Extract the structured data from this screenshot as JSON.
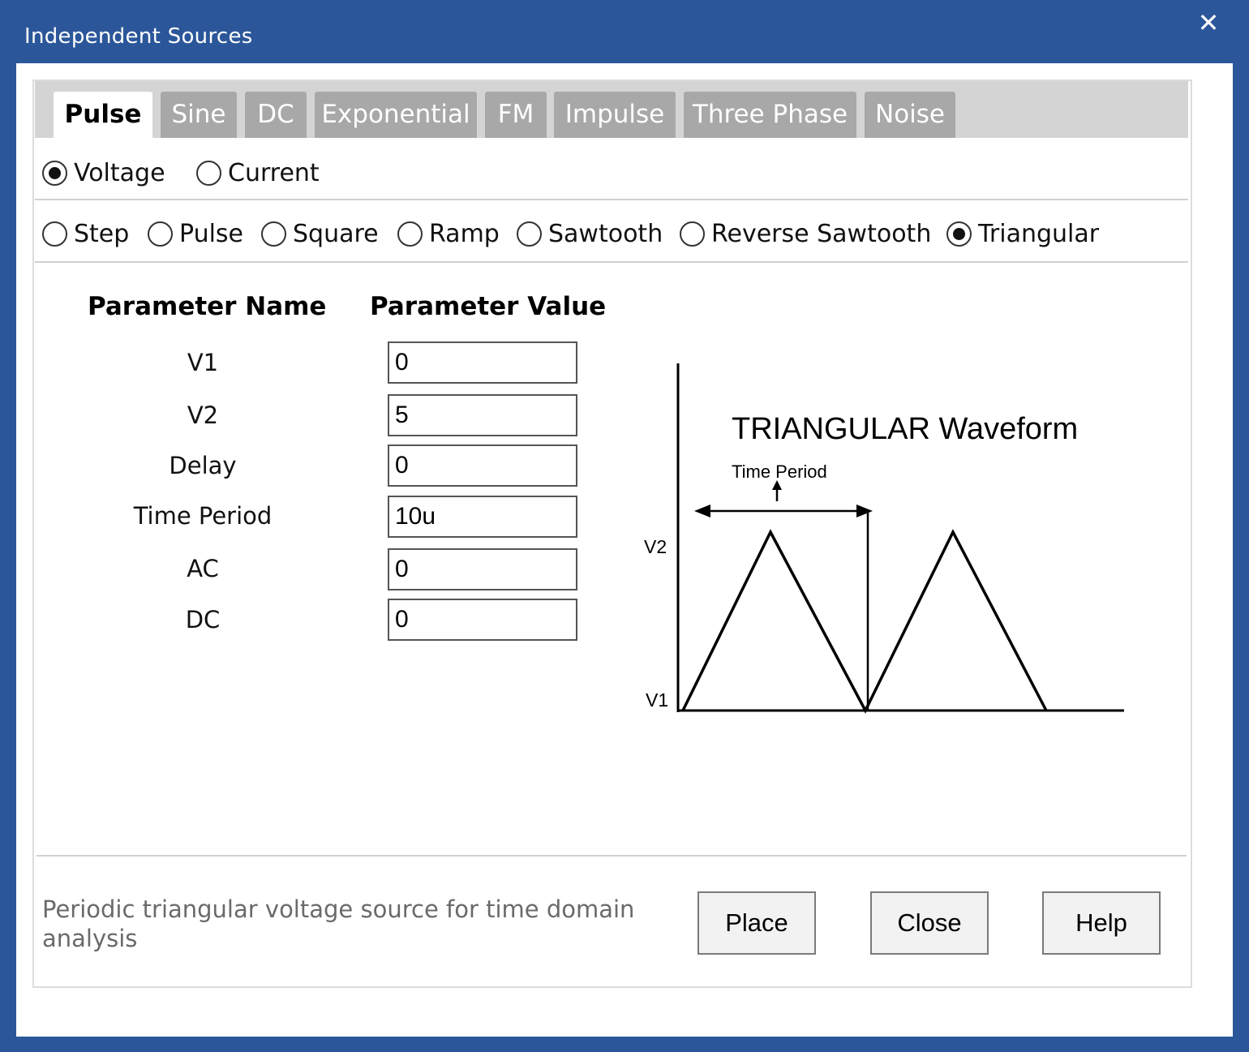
{
  "window": {
    "title": "Independent Sources"
  },
  "tabs": [
    "Pulse",
    "Sine",
    "DC",
    "Exponential",
    "FM",
    "Impulse",
    "Three Phase",
    "Noise"
  ],
  "active_tab": "Pulse",
  "source_type": {
    "options": [
      "Voltage",
      "Current"
    ],
    "selected": "Voltage"
  },
  "waveform_type": {
    "options": [
      "Step",
      "Pulse",
      "Square",
      "Ramp",
      "Sawtooth",
      "Reverse Sawtooth",
      "Triangular"
    ],
    "selected": "Triangular"
  },
  "params": {
    "header_name": "Parameter Name",
    "header_value": "Parameter Value",
    "rows": [
      {
        "name": "V1",
        "value": "0"
      },
      {
        "name": "V2",
        "value": "5"
      },
      {
        "name": "Delay",
        "value": "0"
      },
      {
        "name": "Time Period",
        "value": "10u"
      },
      {
        "name": "AC",
        "value": "0"
      },
      {
        "name": "DC",
        "value": "0"
      }
    ]
  },
  "diagram": {
    "title": "TRIANGULAR Waveform",
    "period_label": "Time Period",
    "v2_label": "V2",
    "v1_label": "V1"
  },
  "description": "Periodic triangular voltage source for time domain analysis",
  "buttons": {
    "place": "Place",
    "close": "Close",
    "help": "Help"
  },
  "colors": {
    "titlebar": "#2b579a",
    "tab_inactive": "#a8a8a8",
    "tabstrip": "#d4d4d4"
  }
}
